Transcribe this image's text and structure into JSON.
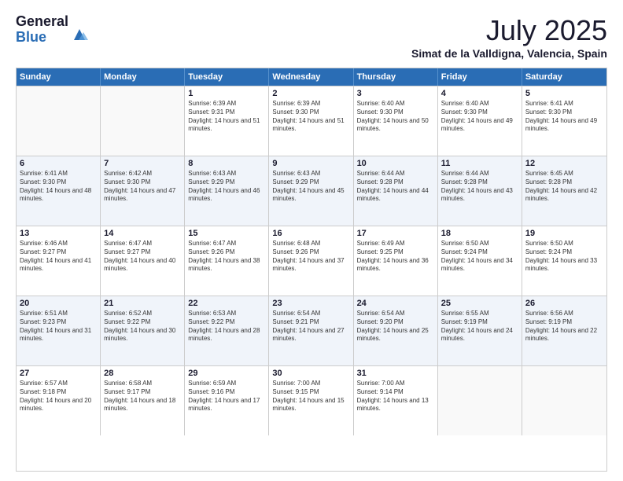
{
  "logo": {
    "general": "General",
    "blue": "Blue"
  },
  "title": "July 2025",
  "location": "Simat de la Valldigna, Valencia, Spain",
  "weekdays": [
    "Sunday",
    "Monday",
    "Tuesday",
    "Wednesday",
    "Thursday",
    "Friday",
    "Saturday"
  ],
  "weeks": [
    [
      {
        "day": "",
        "empty": true
      },
      {
        "day": "",
        "empty": true
      },
      {
        "day": "1",
        "sunrise": "Sunrise: 6:39 AM",
        "sunset": "Sunset: 9:31 PM",
        "daylight": "Daylight: 14 hours and 51 minutes."
      },
      {
        "day": "2",
        "sunrise": "Sunrise: 6:39 AM",
        "sunset": "Sunset: 9:30 PM",
        "daylight": "Daylight: 14 hours and 51 minutes."
      },
      {
        "day": "3",
        "sunrise": "Sunrise: 6:40 AM",
        "sunset": "Sunset: 9:30 PM",
        "daylight": "Daylight: 14 hours and 50 minutes."
      },
      {
        "day": "4",
        "sunrise": "Sunrise: 6:40 AM",
        "sunset": "Sunset: 9:30 PM",
        "daylight": "Daylight: 14 hours and 49 minutes."
      },
      {
        "day": "5",
        "sunrise": "Sunrise: 6:41 AM",
        "sunset": "Sunset: 9:30 PM",
        "daylight": "Daylight: 14 hours and 49 minutes."
      }
    ],
    [
      {
        "day": "6",
        "sunrise": "Sunrise: 6:41 AM",
        "sunset": "Sunset: 9:30 PM",
        "daylight": "Daylight: 14 hours and 48 minutes."
      },
      {
        "day": "7",
        "sunrise": "Sunrise: 6:42 AM",
        "sunset": "Sunset: 9:30 PM",
        "daylight": "Daylight: 14 hours and 47 minutes."
      },
      {
        "day": "8",
        "sunrise": "Sunrise: 6:43 AM",
        "sunset": "Sunset: 9:29 PM",
        "daylight": "Daylight: 14 hours and 46 minutes."
      },
      {
        "day": "9",
        "sunrise": "Sunrise: 6:43 AM",
        "sunset": "Sunset: 9:29 PM",
        "daylight": "Daylight: 14 hours and 45 minutes."
      },
      {
        "day": "10",
        "sunrise": "Sunrise: 6:44 AM",
        "sunset": "Sunset: 9:28 PM",
        "daylight": "Daylight: 14 hours and 44 minutes."
      },
      {
        "day": "11",
        "sunrise": "Sunrise: 6:44 AM",
        "sunset": "Sunset: 9:28 PM",
        "daylight": "Daylight: 14 hours and 43 minutes."
      },
      {
        "day": "12",
        "sunrise": "Sunrise: 6:45 AM",
        "sunset": "Sunset: 9:28 PM",
        "daylight": "Daylight: 14 hours and 42 minutes."
      }
    ],
    [
      {
        "day": "13",
        "sunrise": "Sunrise: 6:46 AM",
        "sunset": "Sunset: 9:27 PM",
        "daylight": "Daylight: 14 hours and 41 minutes."
      },
      {
        "day": "14",
        "sunrise": "Sunrise: 6:47 AM",
        "sunset": "Sunset: 9:27 PM",
        "daylight": "Daylight: 14 hours and 40 minutes."
      },
      {
        "day": "15",
        "sunrise": "Sunrise: 6:47 AM",
        "sunset": "Sunset: 9:26 PM",
        "daylight": "Daylight: 14 hours and 38 minutes."
      },
      {
        "day": "16",
        "sunrise": "Sunrise: 6:48 AM",
        "sunset": "Sunset: 9:26 PM",
        "daylight": "Daylight: 14 hours and 37 minutes."
      },
      {
        "day": "17",
        "sunrise": "Sunrise: 6:49 AM",
        "sunset": "Sunset: 9:25 PM",
        "daylight": "Daylight: 14 hours and 36 minutes."
      },
      {
        "day": "18",
        "sunrise": "Sunrise: 6:50 AM",
        "sunset": "Sunset: 9:24 PM",
        "daylight": "Daylight: 14 hours and 34 minutes."
      },
      {
        "day": "19",
        "sunrise": "Sunrise: 6:50 AM",
        "sunset": "Sunset: 9:24 PM",
        "daylight": "Daylight: 14 hours and 33 minutes."
      }
    ],
    [
      {
        "day": "20",
        "sunrise": "Sunrise: 6:51 AM",
        "sunset": "Sunset: 9:23 PM",
        "daylight": "Daylight: 14 hours and 31 minutes."
      },
      {
        "day": "21",
        "sunrise": "Sunrise: 6:52 AM",
        "sunset": "Sunset: 9:22 PM",
        "daylight": "Daylight: 14 hours and 30 minutes."
      },
      {
        "day": "22",
        "sunrise": "Sunrise: 6:53 AM",
        "sunset": "Sunset: 9:22 PM",
        "daylight": "Daylight: 14 hours and 28 minutes."
      },
      {
        "day": "23",
        "sunrise": "Sunrise: 6:54 AM",
        "sunset": "Sunset: 9:21 PM",
        "daylight": "Daylight: 14 hours and 27 minutes."
      },
      {
        "day": "24",
        "sunrise": "Sunrise: 6:54 AM",
        "sunset": "Sunset: 9:20 PM",
        "daylight": "Daylight: 14 hours and 25 minutes."
      },
      {
        "day": "25",
        "sunrise": "Sunrise: 6:55 AM",
        "sunset": "Sunset: 9:19 PM",
        "daylight": "Daylight: 14 hours and 24 minutes."
      },
      {
        "day": "26",
        "sunrise": "Sunrise: 6:56 AM",
        "sunset": "Sunset: 9:19 PM",
        "daylight": "Daylight: 14 hours and 22 minutes."
      }
    ],
    [
      {
        "day": "27",
        "sunrise": "Sunrise: 6:57 AM",
        "sunset": "Sunset: 9:18 PM",
        "daylight": "Daylight: 14 hours and 20 minutes."
      },
      {
        "day": "28",
        "sunrise": "Sunrise: 6:58 AM",
        "sunset": "Sunset: 9:17 PM",
        "daylight": "Daylight: 14 hours and 18 minutes."
      },
      {
        "day": "29",
        "sunrise": "Sunrise: 6:59 AM",
        "sunset": "Sunset: 9:16 PM",
        "daylight": "Daylight: 14 hours and 17 minutes."
      },
      {
        "day": "30",
        "sunrise": "Sunrise: 7:00 AM",
        "sunset": "Sunset: 9:15 PM",
        "daylight": "Daylight: 14 hours and 15 minutes."
      },
      {
        "day": "31",
        "sunrise": "Sunrise: 7:00 AM",
        "sunset": "Sunset: 9:14 PM",
        "daylight": "Daylight: 14 hours and 13 minutes."
      },
      {
        "day": "",
        "empty": true
      },
      {
        "day": "",
        "empty": true
      }
    ]
  ]
}
